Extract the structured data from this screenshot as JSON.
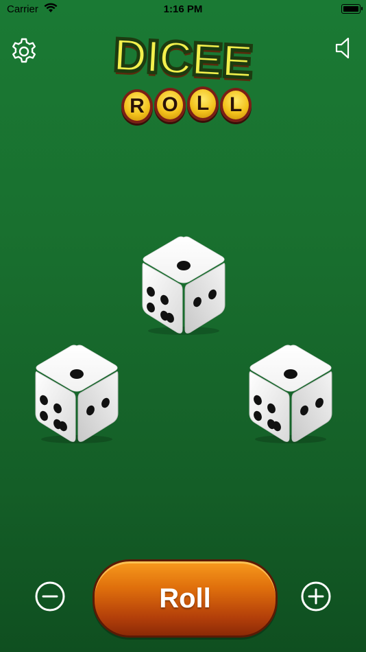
{
  "status_bar": {
    "carrier": "Carrier",
    "time": "1:16 PM",
    "wifi_icon": "wifi-icon",
    "battery_icon": "battery-icon"
  },
  "toolbar": {
    "settings_icon": "gear-icon",
    "sound_icon": "speaker-icon"
  },
  "logo": {
    "line1": "DICEE",
    "line2": [
      "R",
      "O",
      "L",
      "L"
    ]
  },
  "dice": [
    {
      "name": "die-top",
      "value": 5
    },
    {
      "name": "die-left",
      "value": 5
    },
    {
      "name": "die-right",
      "value": 5
    }
  ],
  "controls": {
    "roll_label": "Roll",
    "decrease_icon": "minus-circle-icon",
    "increase_icon": "plus-circle-icon"
  },
  "colors": {
    "background": "#19702f",
    "roll_button": "#e0700c",
    "logo_yellow": "#f2f04c",
    "coin_gold": "#f3c21c"
  }
}
